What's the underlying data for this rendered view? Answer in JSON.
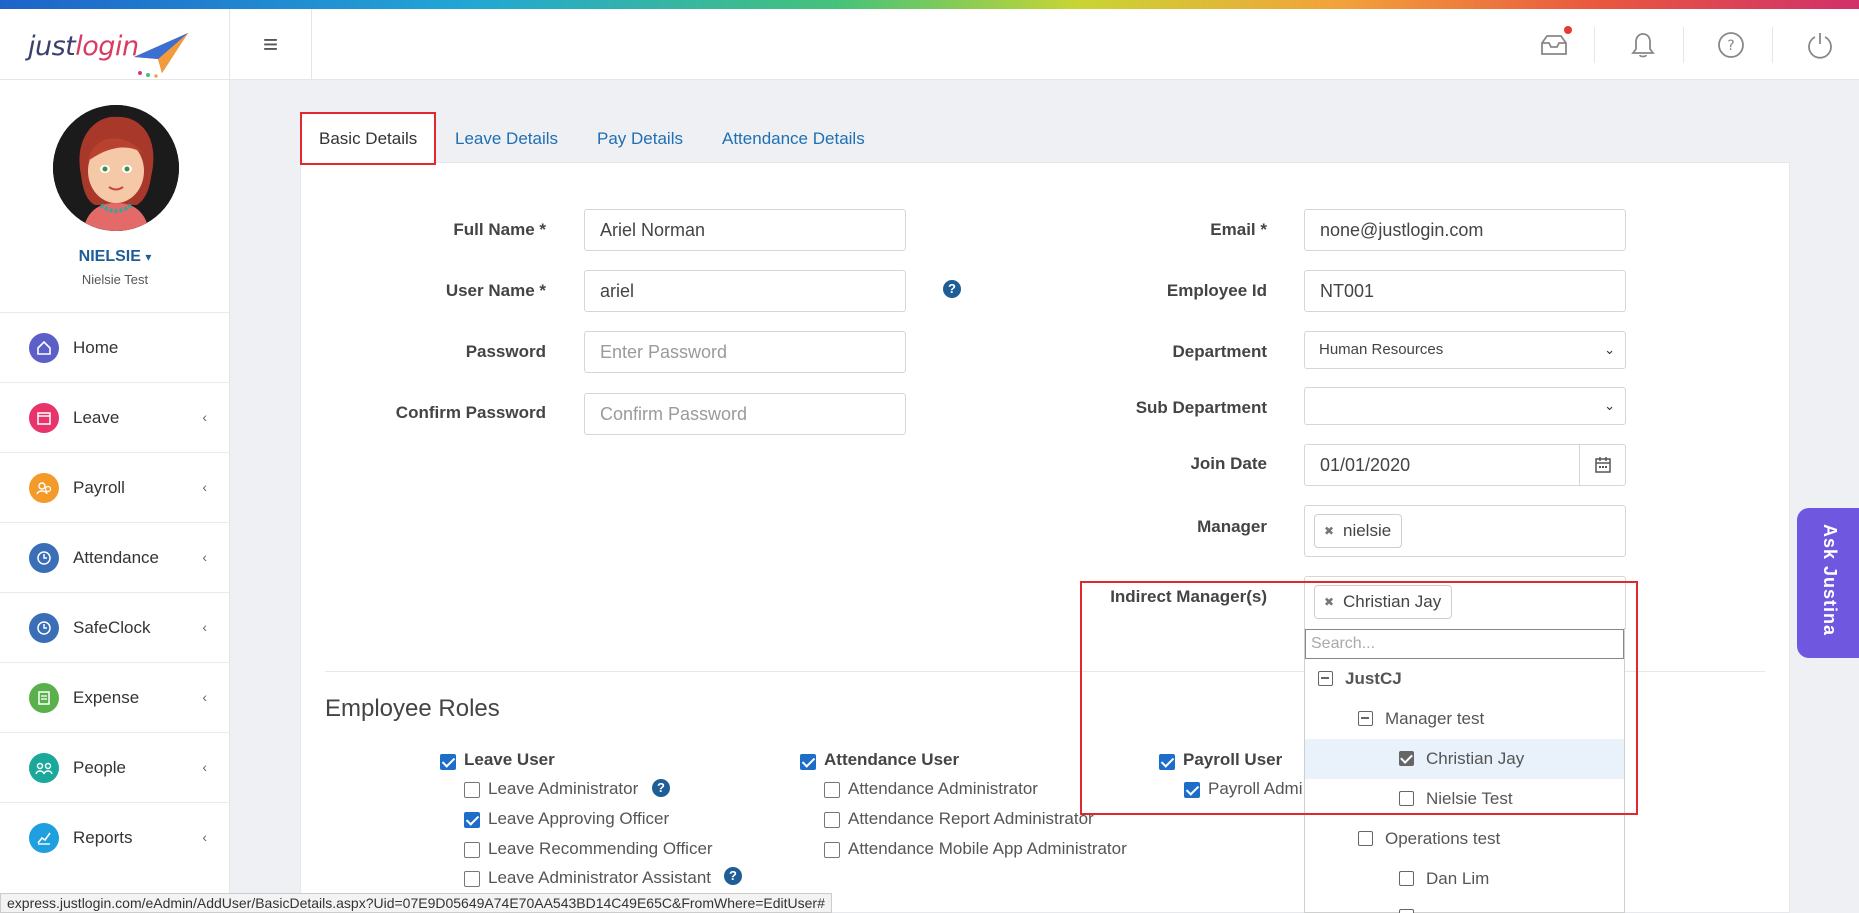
{
  "app": {
    "logo_just": "just",
    "logo_login": "login",
    "menu_icon": "hamburger-icon"
  },
  "topbar": {
    "icons": [
      "inbox-icon",
      "bell-icon",
      "help-circle-icon",
      "power-icon"
    ],
    "notif_color": "#e53935"
  },
  "profile": {
    "name": "NIELSIE",
    "name_caret": "▾",
    "subtitle": "Nielsie Test"
  },
  "sidebar": {
    "items": [
      {
        "label": "Home",
        "icon": "home-icon",
        "color": "#5b5fc7",
        "chevron": ""
      },
      {
        "label": "Leave",
        "icon": "calendar-icon",
        "color": "#e8336b",
        "chevron": "‹"
      },
      {
        "label": "Payroll",
        "icon": "payroll-icon",
        "color": "#f39a2b",
        "chevron": "‹"
      },
      {
        "label": "Attendance",
        "icon": "clock-icon",
        "color": "#3a6fb8",
        "chevron": "‹"
      },
      {
        "label": "SafeClock",
        "icon": "safeclock-icon",
        "color": "#3a6fb8",
        "chevron": "‹"
      },
      {
        "label": "Expense",
        "icon": "expense-icon",
        "color": "#5ab04a",
        "chevron": "‹"
      },
      {
        "label": "People",
        "icon": "people-icon",
        "color": "#1aa89a",
        "chevron": "‹"
      },
      {
        "label": "Reports",
        "icon": "reports-icon",
        "color": "#1e9fe0",
        "chevron": "‹"
      }
    ]
  },
  "tabs": [
    {
      "label": "Basic Details",
      "active": true
    },
    {
      "label": "Leave Details",
      "active": false
    },
    {
      "label": "Pay Details",
      "active": false
    },
    {
      "label": "Attendance Details",
      "active": false
    }
  ],
  "form": {
    "full_name": {
      "label": "Full Name *",
      "value": "Ariel Norman"
    },
    "user_name": {
      "label": "User Name *",
      "value": "ariel"
    },
    "password": {
      "label": "Password",
      "placeholder": "Enter Password"
    },
    "confirm_password": {
      "label": "Confirm Password",
      "placeholder": "Confirm Password"
    },
    "email": {
      "label": "Email *",
      "value": "none@justlogin.com"
    },
    "employee_id": {
      "label": "Employee Id",
      "value": "NT001"
    },
    "department": {
      "label": "Department",
      "value": "Human Resources"
    },
    "sub_department": {
      "label": "Sub Department",
      "value": ""
    },
    "join_date": {
      "label": "Join Date",
      "value": "01/01/2020"
    },
    "manager": {
      "label": "Manager",
      "tag": "nielsie"
    },
    "indirect_managers": {
      "label": "Indirect Manager(s)",
      "tag": "Christian Jay"
    }
  },
  "dropdown": {
    "search_placeholder": "Search...",
    "tree": [
      {
        "label": "JustCJ",
        "level": 0,
        "state": "minus",
        "bold": true
      },
      {
        "label": "Manager test",
        "level": 1,
        "state": "minus"
      },
      {
        "label": "Christian Jay",
        "level": 2,
        "state": "checked",
        "highlight": true
      },
      {
        "label": "Nielsie Test",
        "level": 2,
        "state": "empty"
      },
      {
        "label": "Operations test",
        "level": 1,
        "state": "empty"
      },
      {
        "label": "Dan Lim",
        "level": 2,
        "state": "empty"
      }
    ]
  },
  "roles": {
    "title": "Employee Roles",
    "leave": {
      "main": {
        "label": "Leave User",
        "checked": true
      },
      "subs": [
        {
          "label": "Leave Administrator",
          "checked": false,
          "help": true
        },
        {
          "label": "Leave Approving Officer",
          "checked": true
        },
        {
          "label": "Leave Recommending Officer",
          "checked": false
        },
        {
          "label": "Leave Administrator Assistant",
          "checked": false,
          "help": true
        }
      ]
    },
    "attendance": {
      "main": {
        "label": "Attendance User",
        "checked": true
      },
      "subs": [
        {
          "label": "Attendance Administrator",
          "checked": false
        },
        {
          "label": "Attendance Report Administrator",
          "checked": false
        },
        {
          "label": "Attendance Mobile App Administrator",
          "checked": false
        }
      ]
    },
    "payroll": {
      "main": {
        "label": "Payroll User",
        "checked": true
      },
      "subs": [
        {
          "label": "Payroll Admi",
          "checked": true
        }
      ]
    }
  },
  "ask_button": "Ask Justina",
  "status_url": "express.justlogin.com/eAdmin/AddUser/BasicDetails.aspx?Uid=07E9D05649A74E70AA543BD14C49E65C&FromWhere=EditUser#",
  "help_glyph": "?",
  "remove_glyph": "✖"
}
